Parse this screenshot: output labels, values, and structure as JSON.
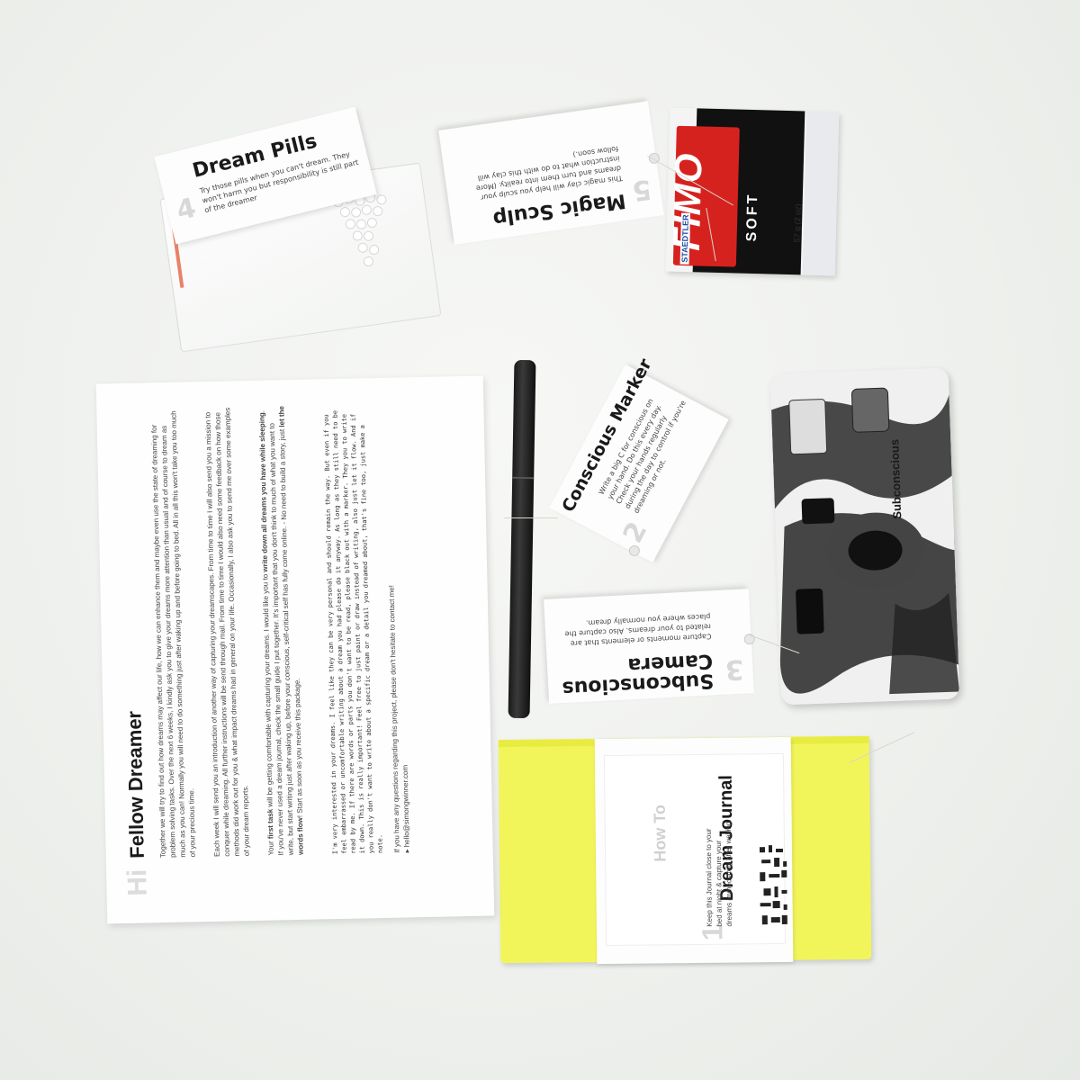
{
  "tags": {
    "dream_pills": {
      "number": "4",
      "title": "Dream Pills",
      "body": "Try those pills when you can't dream. They won't harm you but responsibility is still part of the dreamer"
    },
    "magic_sculp": {
      "number": "5",
      "title": "Magic Sculp",
      "body": "This magic clay will help you sculp your dreams and turn them into reality. (More instruction what to do with this clay will follow soon.)"
    },
    "conscious_marker": {
      "number": "2",
      "title": "Conscious Marker",
      "body": "Write a big C for conscious on your hand. Do this every day. Check your hands regularly during the day to control if you're dreaming or not."
    },
    "subconscious_camera": {
      "number": "3",
      "title_line1": "Subconscious",
      "title_line2": "Camera",
      "body": "Capture moments or elements that are related to your dreams. Also capture the places where you normally dream."
    },
    "dream_journal": {
      "number": "1",
      "how_to": "How To",
      "title": "Dream Journal",
      "body": "Keep this Journal close to your bed at night & capture your dreams immediately after waking."
    }
  },
  "clay": {
    "brand": "FIMO",
    "line": "SOFT",
    "maker": "STAEDTLER",
    "weight": "57 g (2 oz)"
  },
  "camera": {
    "label": "Subconscious"
  },
  "letter": {
    "hi": "Hi",
    "greeting": "Fellow Dreamer",
    "p1": "Together we will try to find out how dreams may affect our life, how we can enhance them and maybe even use the state of dreaming for problem solving tasks. Over the next 6 weeks, I kindly ask you to give your dreams more attention than usual and of course to dream as much as you can! Normally you will need to do something just after waking up and before going to bed. All in all this won't take you too much of your precious time.",
    "p2": "Each week I will send you an introduction of another way of capturing your dreamscapes. From time to time I will also send you a mission to conquer while dreaming. All further instructions will be send through mail. From time to time I would also need some feedback on how those methods did work out for you & what impact dreams had in general on your life. Occasionally, I also ask you to send me over some examples of your dream reports.",
    "p3a": "Your ",
    "p3b": "first task",
    "p3c": " will be getting comfortable with capturing your dreams. I would like you to ",
    "p3d": "write down all dreams you have while sleeping",
    "p3e": ". If you've never used a dream journal, check the small guide I put together. It's important that you don't think to much of what you want to write, but start writing just after waking up, before your conscious, self-critical self has fully come online. - No need to build a story, just ",
    "p3f": "let the words flow",
    "p3g": "! Start as soon as you receive this package.",
    "p4": "I'm very interested in your dreams. I feel like they can be very personal and should remain the way. But even if you feel embarrassed or uncomfortable writing about a dream you had please do it anyway. As long as they still need to be read by me. If there are words or parts you don't want to be read, please black out with a marker. They you to write it down. This is really important! Feel free to just paint or draw instead of writing, also just let it flow. And if you really don't want to write about a specific dream or a detail you dreamed about, that's fine too, just make a note.",
    "p5": "If you have any questions regarding this project, please don't hesitate to contact me!",
    "email": "hello@simongwinner.com"
  }
}
